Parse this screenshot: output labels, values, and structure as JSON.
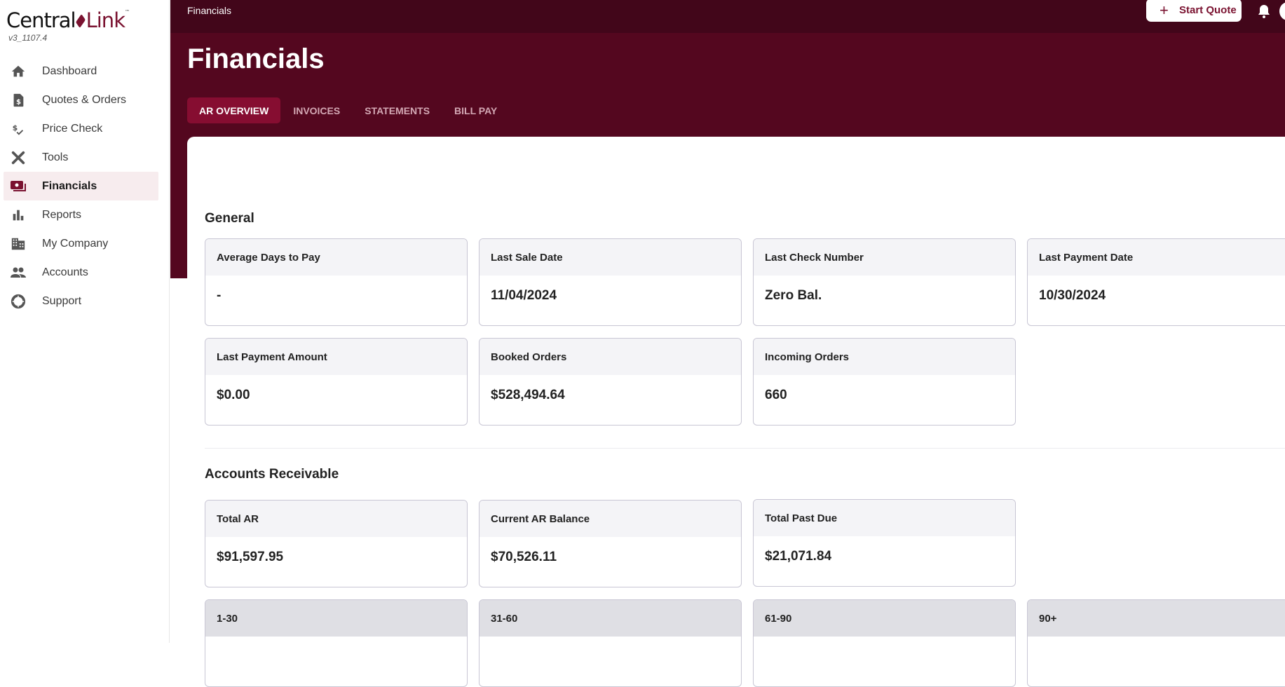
{
  "app": {
    "logo_left": "Central",
    "logo_right": "Link",
    "logo_tm": "™",
    "version": "v3_1107.4"
  },
  "sidebar": {
    "items": [
      {
        "label": "Dashboard",
        "icon": "home-icon",
        "active": false
      },
      {
        "label": "Quotes & Orders",
        "icon": "invoice-dollar-icon",
        "active": false
      },
      {
        "label": "Price Check",
        "icon": "price-check-icon",
        "active": false
      },
      {
        "label": "Tools",
        "icon": "tools-icon",
        "active": false
      },
      {
        "label": "Financials",
        "icon": "money-icon",
        "active": true
      },
      {
        "label": "Reports",
        "icon": "bar-chart-icon",
        "active": false
      },
      {
        "label": "My Company",
        "icon": "building-icon",
        "active": false
      },
      {
        "label": "Accounts",
        "icon": "people-icon",
        "active": false
      },
      {
        "label": "Support",
        "icon": "lifebuoy-icon",
        "active": false
      }
    ]
  },
  "topbar": {
    "breadcrumb": "Financials",
    "start_quote_label": "Start Quote"
  },
  "header": {
    "title": "Financials",
    "tabs": [
      {
        "label": "AR OVERVIEW",
        "active": true
      },
      {
        "label": "INVOICES",
        "active": false
      },
      {
        "label": "STATEMENTS",
        "active": false
      },
      {
        "label": "BILL PAY",
        "active": false
      }
    ]
  },
  "general": {
    "title": "General",
    "cards": [
      {
        "label": "Average Days to Pay",
        "value": "-"
      },
      {
        "label": "Last Sale Date",
        "value": "11/04/2024"
      },
      {
        "label": "Last Check Number",
        "value": "Zero Bal."
      },
      {
        "label": "Last Payment Date",
        "value": "10/30/2024"
      },
      {
        "label": "Last Payment Amount",
        "value": "$0.00"
      },
      {
        "label": "Booked Orders",
        "value": "$528,494.64"
      },
      {
        "label": "Incoming Orders",
        "value": "660"
      }
    ]
  },
  "ar": {
    "title": "Accounts Receivable",
    "cards": [
      {
        "label": "Total AR",
        "value": "$91,597.95"
      },
      {
        "label": "Current AR Balance",
        "value": "$70,526.11"
      },
      {
        "label": "Total Past Due",
        "value": "$21,071.84"
      }
    ],
    "aging": [
      {
        "label": "1-30"
      },
      {
        "label": "31-60"
      },
      {
        "label": "61-90"
      },
      {
        "label": "90+"
      }
    ]
  },
  "colors": {
    "brand": "#7a1230",
    "topbar": "#42061a",
    "hero": "#54071f",
    "active_tab": "#860d31"
  }
}
